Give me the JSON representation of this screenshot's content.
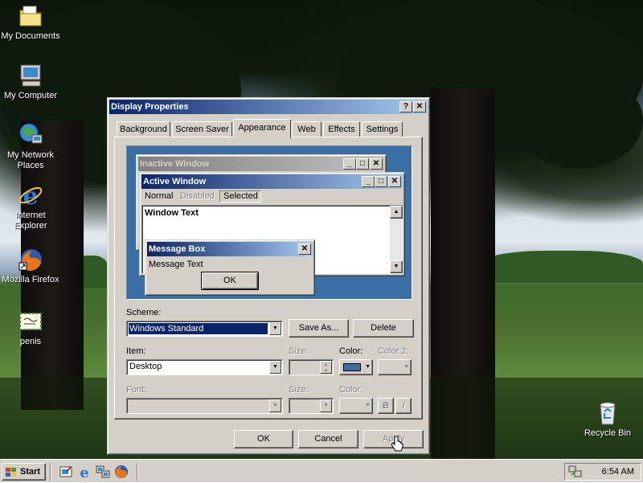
{
  "desktop": {
    "icons": [
      {
        "id": "my-documents",
        "label": "My Documents"
      },
      {
        "id": "my-computer",
        "label": "My Computer"
      },
      {
        "id": "my-network-places",
        "label": "My Network Places"
      },
      {
        "id": "internet-explorer",
        "label": "Internet Explorer"
      },
      {
        "id": "mozilla-firefox",
        "label": "Mozilla Firefox"
      },
      {
        "id": "penis",
        "label": "penis"
      },
      {
        "id": "recycle-bin",
        "label": "Recycle Bin"
      }
    ]
  },
  "window": {
    "title": "Display Properties",
    "help_glyph": "?",
    "close_glyph": "✕",
    "tabs": [
      "Background",
      "Screen Saver",
      "Appearance",
      "Web",
      "Effects",
      "Settings"
    ],
    "active_tab": "Appearance",
    "preview": {
      "inactive_title": "Inactive Window",
      "active_title": "Active Window",
      "menu": {
        "normal": "Normal",
        "disabled": "Disabled",
        "selected": "Selected"
      },
      "window_text": "Window Text",
      "message_box_title": "Message Box",
      "message_text": "Message Text",
      "ok_label": "OK",
      "min_glyph": "_",
      "max_glyph": "□",
      "close_glyph": "✕"
    },
    "scheme": {
      "label": "Scheme:",
      "value": "Windows Standard",
      "save_as_label": "Save As...",
      "delete_label": "Delete"
    },
    "item": {
      "label": "Item:",
      "value": "Desktop",
      "size_label": "Size:",
      "color_label": "Color:",
      "color2_label": "Color 2:",
      "color_value": "#3a6ea5"
    },
    "font": {
      "label": "Font:",
      "size_label": "Size:",
      "color_label": "Color:",
      "bold_label": "B",
      "italic_label": "I"
    },
    "buttons": {
      "ok": "OK",
      "cancel": "Cancel",
      "apply": "Apply"
    }
  },
  "taskbar": {
    "start_label": "Start",
    "clock": "6:54 AM"
  }
}
